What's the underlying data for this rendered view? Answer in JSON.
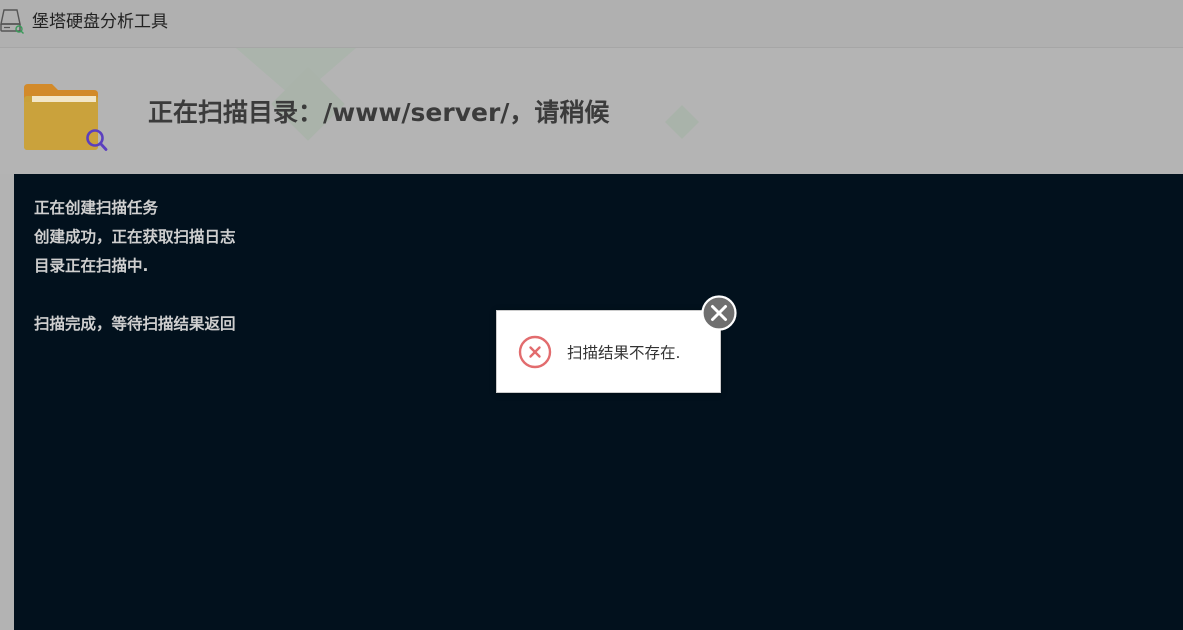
{
  "window": {
    "title": "堡塔硬盘分析工具",
    "icon": "hard-drive-search-icon"
  },
  "header": {
    "icon": "folder-search-icon",
    "title": "正在扫描目录：/www/server/，请稍候"
  },
  "console": {
    "lines": [
      "正在创建扫描任务",
      "创建成功，正在获取扫描日志",
      "目录正在扫描中.",
      "",
      "扫描完成，等待扫描结果返回"
    ]
  },
  "message": {
    "icon": "error-circle-icon",
    "text": "扫描结果不存在.",
    "close_icon": "close-circle-icon"
  },
  "colors": {
    "console_bg": "#02111d",
    "error": "#e26c6e",
    "folder": "#e0a73c",
    "search_accent": "#5b3fbf"
  }
}
